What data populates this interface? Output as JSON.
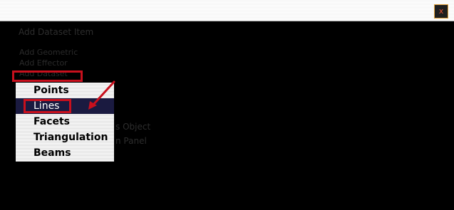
{
  "window": {
    "close_label": "x"
  },
  "background_text": {
    "heading": "Add Dataset Item",
    "menu_items": [
      "Add Geometric",
      "Add Effector",
      "Add Dataset"
    ],
    "right_text_1": "s Object",
    "right_text_2": "n Panel"
  },
  "dropdown": {
    "items": [
      {
        "label": "Points",
        "selected": false
      },
      {
        "label": "Lines",
        "selected": true
      },
      {
        "label": "Facets",
        "selected": false
      },
      {
        "label": "Triangulation",
        "selected": false
      },
      {
        "label": "Beams",
        "selected": false
      }
    ]
  },
  "annotation": {
    "color": "#c8101d"
  }
}
